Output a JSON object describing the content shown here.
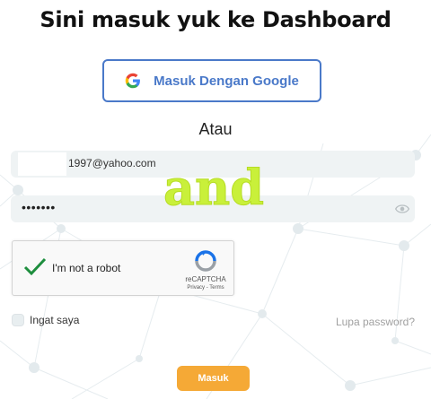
{
  "heading": "Sini masuk yuk ke Dashboard",
  "google_button": {
    "label": "Masuk Dengan Google",
    "icon": "google-g-icon"
  },
  "divider_text": "Atau",
  "email_field": {
    "value": "1997@yahoo.com"
  },
  "password_field": {
    "value": "•••••••",
    "icon": "eye-icon"
  },
  "captcha": {
    "label": "I'm not a robot",
    "checked": true,
    "brand": "reCAPTCHA",
    "links": "Privacy - Terms"
  },
  "remember_me": {
    "label": "Ingat saya",
    "checked": false
  },
  "forgot_password": "Lupa password?",
  "submit_button": "Masuk",
  "watermark_text": "and",
  "colors": {
    "accent_blue": "#4a79c9",
    "submit_orange": "#f5a936",
    "watermark_green": "#c9f03a",
    "field_bg": "#eff3f4",
    "check_green": "#1e8e3e"
  }
}
